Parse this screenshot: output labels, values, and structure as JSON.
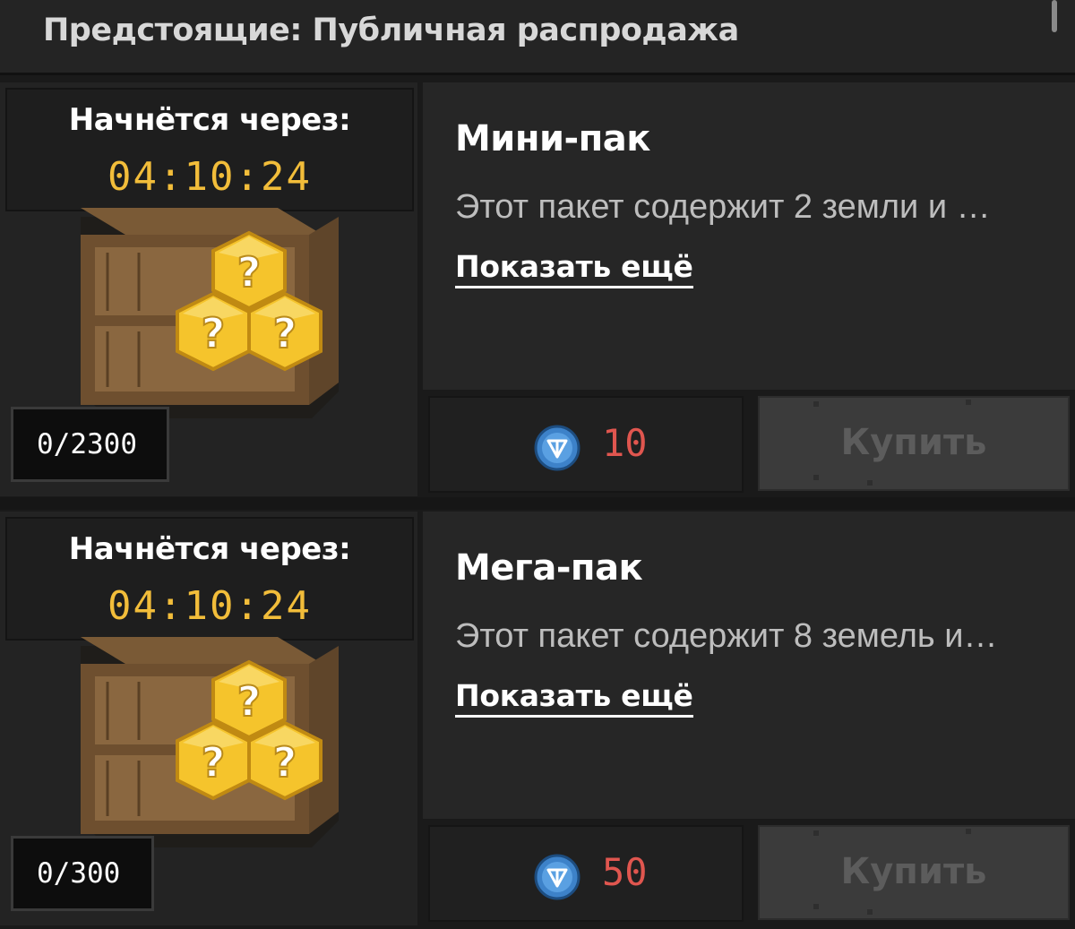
{
  "header": {
    "title": "Предстоящие: Публичная распродажа"
  },
  "cards": [
    {
      "timer_label": "Начнётся через:",
      "timer_value": "04:10:24",
      "count": "0/2300",
      "title": "Мини-пак",
      "description": "Этот пакет содержит 2 земли и …",
      "show_more": "Показать ещё",
      "price": "10",
      "buy_label": "Купить"
    },
    {
      "timer_label": "Начнётся через:",
      "timer_value": "04:10:24",
      "count": "0/300",
      "title": "Мега-пак",
      "description": "Этот пакет содержит 8 земель и…",
      "show_more": "Показать ещё",
      "price": "50",
      "buy_label": "Купить"
    }
  ],
  "icons": {
    "currency": "ton-coin-icon",
    "crate": "mystery-crate-icon"
  },
  "colors": {
    "timer": "#f2bd3a",
    "price": "#e0564f",
    "button_disabled": "#3b3b3b"
  }
}
